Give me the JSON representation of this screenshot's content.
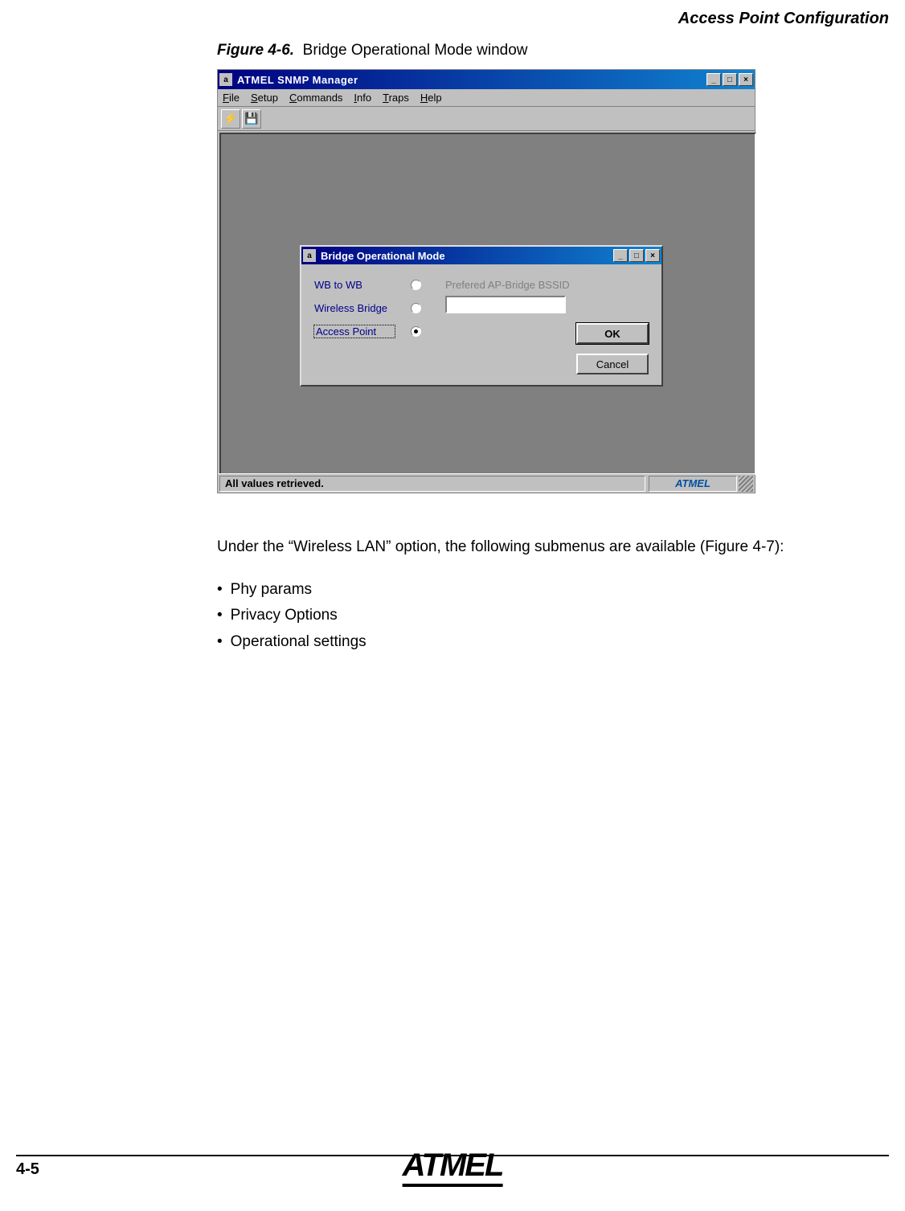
{
  "page": {
    "header": "Access Point Configuration",
    "figure_label": "Figure 4-6.",
    "figure_title": "Bridge Operational Mode window",
    "paragraph": "Under the “Wireless LAN” option, the following submenus are available (Figure 4-7):",
    "bullets": [
      "Phy params",
      "Privacy Options",
      "Operational settings"
    ],
    "page_number": "4-5",
    "footer_brand": "ATMEL"
  },
  "main_window": {
    "title": "ATMEL SNMP Manager",
    "menus": [
      "File",
      "Setup",
      "Commands",
      "Info",
      "Traps",
      "Help"
    ],
    "toolbar_icons": [
      "lightning-icon",
      "save-icon"
    ],
    "status_text": "All values retrieved.",
    "status_brand": "ATMEL"
  },
  "dialog": {
    "title": "Bridge Operational Mode",
    "options": [
      {
        "label": "WB to WB",
        "selected": false
      },
      {
        "label": "Wireless Bridge",
        "selected": false
      },
      {
        "label": "Access Point",
        "selected": true
      }
    ],
    "bssid_label": "Prefered AP-Bridge BSSID",
    "bssid_value": "",
    "ok": "OK",
    "cancel": "Cancel"
  }
}
